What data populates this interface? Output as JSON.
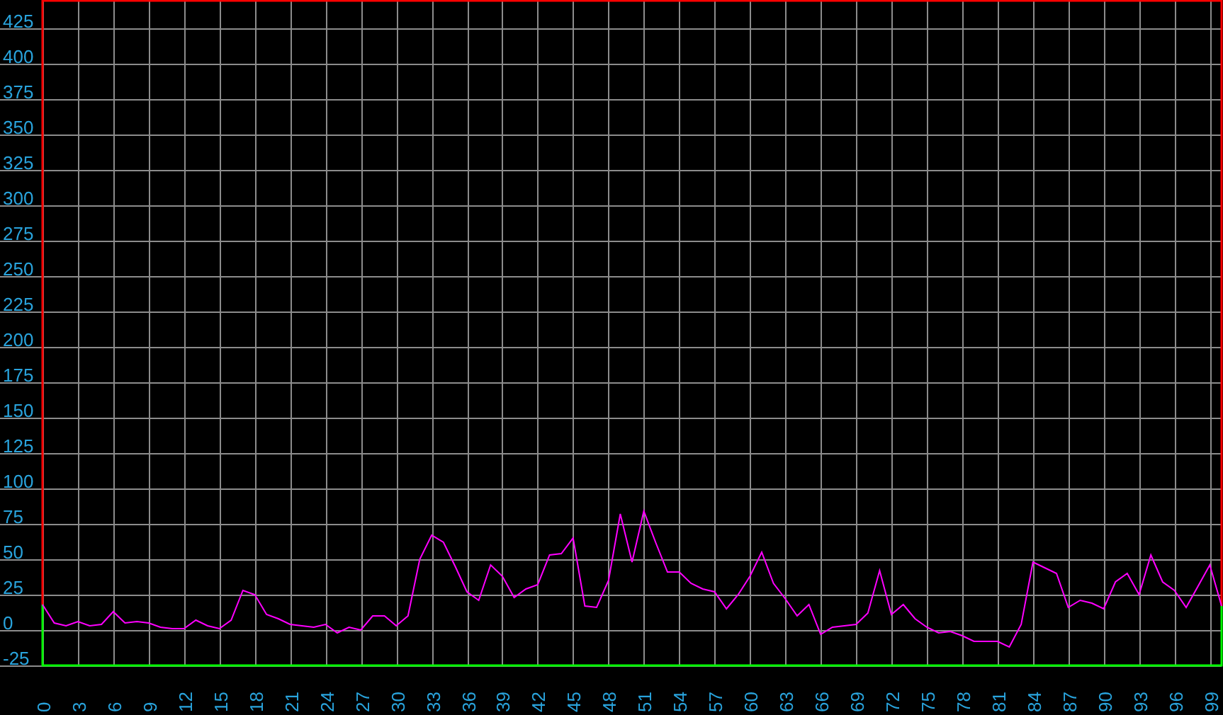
{
  "chart": {
    "chart_data": {
      "type": "line",
      "grid": true,
      "x": [
        0,
        1,
        2,
        3,
        4,
        5,
        6,
        7,
        8,
        9,
        10,
        11,
        12,
        13,
        14,
        15,
        16,
        17,
        18,
        19,
        20,
        21,
        22,
        23,
        24,
        25,
        26,
        27,
        28,
        29,
        30,
        31,
        32,
        33,
        34,
        35,
        36,
        37,
        38,
        39,
        40,
        41,
        42,
        43,
        44,
        45,
        46,
        47,
        48,
        49,
        50,
        51,
        52,
        53,
        54,
        55,
        56,
        57,
        58,
        59,
        60,
        61,
        62,
        63,
        64,
        65,
        66,
        67,
        68,
        69,
        70,
        71,
        72,
        73,
        74,
        75,
        76,
        77,
        78,
        79,
        80,
        81,
        82,
        83,
        84,
        85,
        86,
        87,
        88,
        89,
        90,
        91,
        92,
        93,
        94,
        95,
        96,
        97,
        98,
        99,
        100
      ],
      "series": [
        {
          "color": "#ff00ff",
          "values": [
            18,
            5,
            3,
            6,
            3,
            4,
            13,
            5,
            6,
            5,
            2,
            1,
            1,
            7,
            3,
            1,
            7,
            28,
            25,
            11,
            8,
            4,
            3,
            2,
            4,
            -2,
            2,
            0,
            10,
            10,
            3,
            10,
            50,
            67,
            62,
            45,
            27,
            21,
            46,
            38,
            23,
            29,
            32,
            53,
            54,
            65,
            17,
            16,
            35,
            82,
            48,
            84,
            62,
            41,
            41,
            33,
            29,
            27,
            15,
            25,
            38,
            55,
            33,
            22,
            10,
            18,
            -3,
            2,
            3,
            4,
            12,
            42,
            11,
            18,
            8,
            2,
            -2,
            -1,
            -4,
            -8,
            -8,
            -8,
            -12,
            4,
            48,
            44,
            40,
            16,
            21,
            19,
            15,
            34,
            40,
            25,
            53,
            34,
            28,
            16,
            31,
            46,
            17
          ]
        }
      ],
      "xlim": [
        0,
        100
      ],
      "ylim": [
        -25,
        445
      ],
      "xticks": [
        0,
        3,
        6,
        9,
        12,
        15,
        18,
        21,
        24,
        27,
        30,
        33,
        36,
        39,
        42,
        45,
        48,
        51,
        54,
        57,
        60,
        63,
        66,
        69,
        72,
        75,
        78,
        81,
        84,
        87,
        90,
        93,
        96,
        99
      ],
      "yticks": [
        -25,
        0,
        25,
        50,
        75,
        100,
        125,
        150,
        175,
        200,
        225,
        250,
        275,
        300,
        325,
        350,
        375,
        400,
        425
      ]
    }
  }
}
